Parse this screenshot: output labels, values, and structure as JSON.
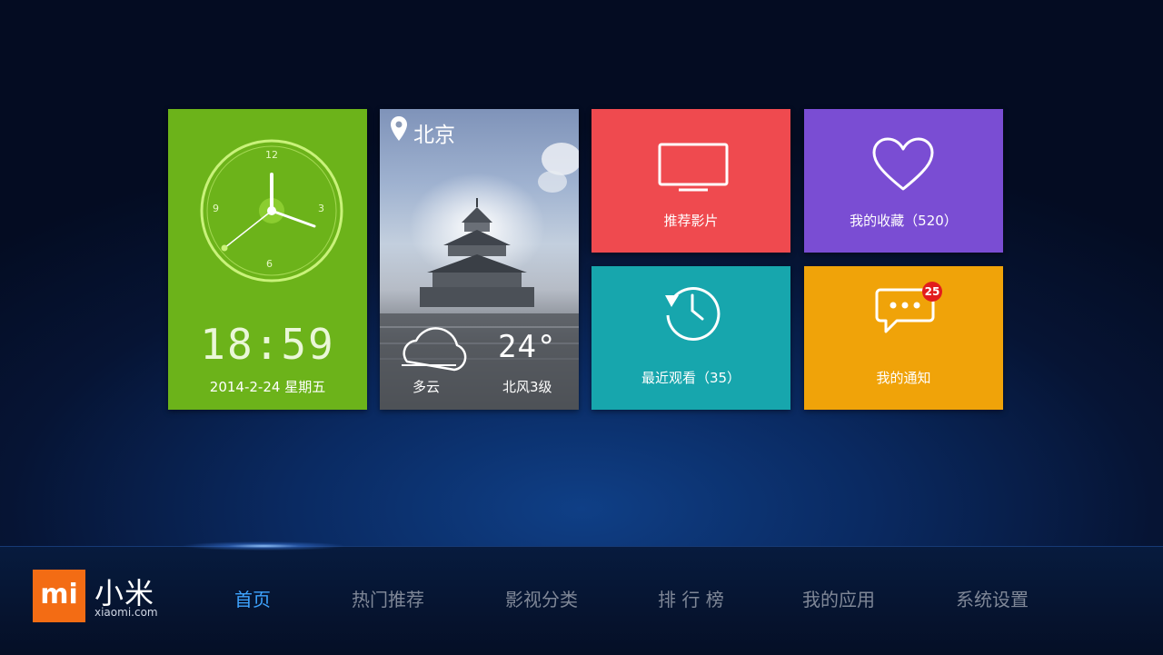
{
  "clock": {
    "time": "18:59",
    "date": "2014-2-24 星期五",
    "dial_numbers": [
      "12",
      "3",
      "6",
      "9"
    ],
    "icon": "analog-clock-icon"
  },
  "weather": {
    "city": "北京",
    "temperature": "24°",
    "condition": "多云",
    "wind": "北风3级",
    "icons": [
      "location-pin-icon",
      "cloud-icon"
    ]
  },
  "tiles": {
    "recommend": {
      "label": "推荐影片",
      "icon": "tv-icon",
      "color": "#ef4a4f"
    },
    "favorites": {
      "label": "我的收藏（520）",
      "icon": "heart-icon",
      "color": "#7a4dd3"
    },
    "recent": {
      "label": "最近观看（35）",
      "icon": "history-clock-icon",
      "color": "#17a6ad"
    },
    "notify": {
      "label": "我的通知",
      "icon": "chat-bubble-icon",
      "badge": "25",
      "color": "#f0a309"
    }
  },
  "brand": {
    "logo_text": "mi",
    "name": "小米",
    "url": "xiaomi.com",
    "logo_color": "#f36c14"
  },
  "nav": {
    "items": [
      "首页",
      "热门推荐",
      "影视分类",
      "排 行 榜",
      "我的应用",
      "系统设置"
    ],
    "active": "首页",
    "active_color": "#3ea4ff"
  }
}
